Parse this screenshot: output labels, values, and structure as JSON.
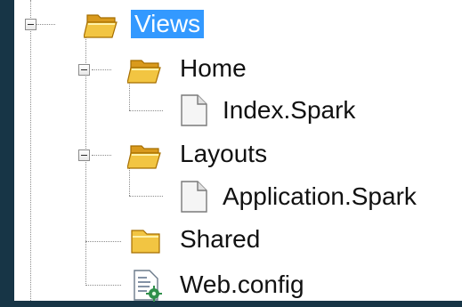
{
  "tree": {
    "views": {
      "label": "Views",
      "icon": "open-folder-icon",
      "state": "expanded",
      "selected": true
    },
    "home": {
      "label": "Home",
      "icon": "open-folder-icon",
      "state": "expanded"
    },
    "index": {
      "label": "Index.Spark",
      "icon": "file-icon"
    },
    "layouts": {
      "label": "Layouts",
      "icon": "open-folder-icon",
      "state": "expanded"
    },
    "application": {
      "label": "Application.Spark",
      "icon": "file-icon"
    },
    "shared": {
      "label": "Shared",
      "icon": "folder-icon"
    },
    "webconfig": {
      "label": "Web.config",
      "icon": "config-file-icon"
    }
  },
  "colors": {
    "background": "#173546",
    "selection": "#3399ff",
    "folder": "#f2c542",
    "tree_lines": "#8c8c8c"
  }
}
